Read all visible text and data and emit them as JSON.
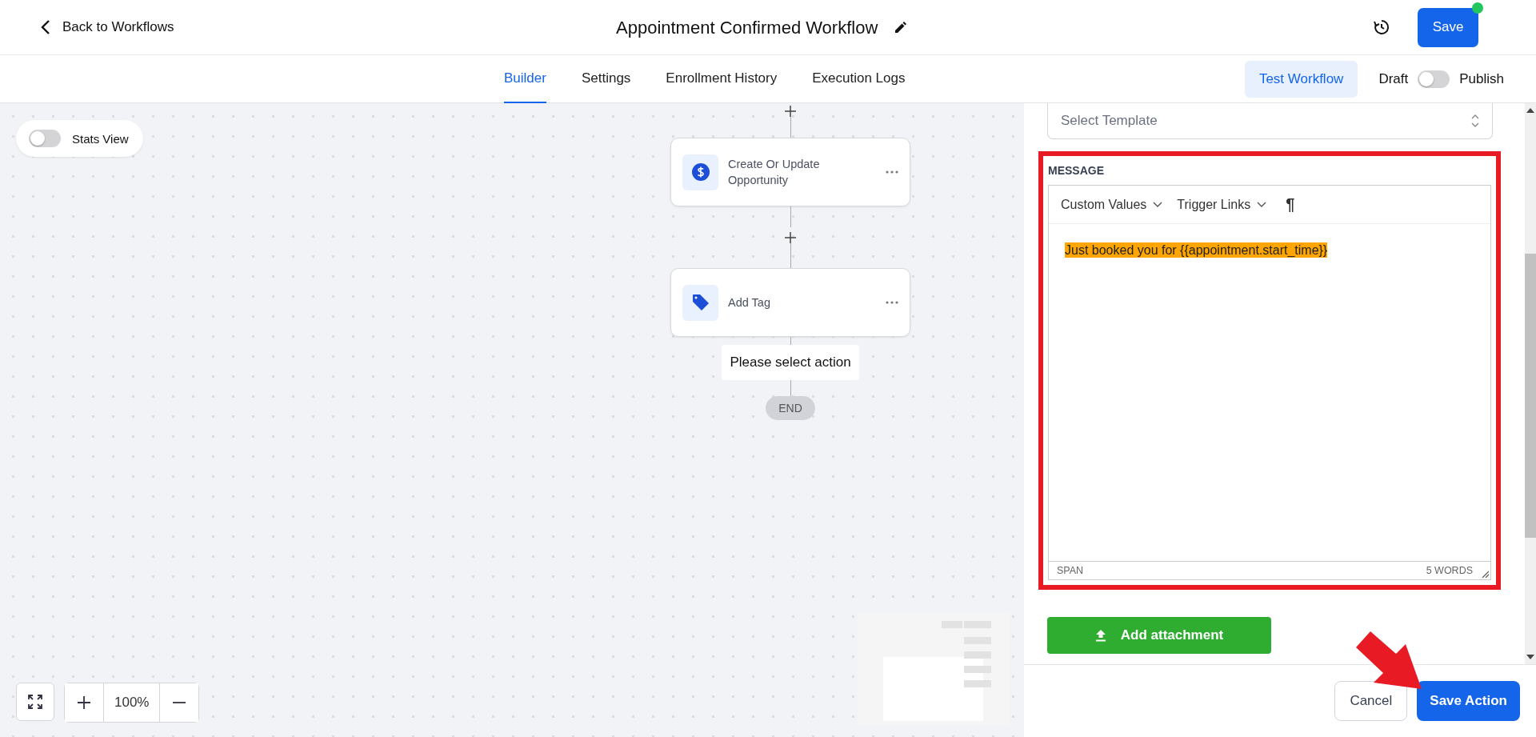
{
  "header": {
    "back_link": "Back to Workflows",
    "title": "Appointment Confirmed Workflow",
    "save_button": "Save",
    "unsaved": true
  },
  "tabs": [
    {
      "label": "Builder",
      "selected": true
    },
    {
      "label": "Settings",
      "selected": false
    },
    {
      "label": "Enrollment History",
      "selected": false
    },
    {
      "label": "Execution Logs",
      "selected": false
    }
  ],
  "test_button": "Test Workflow",
  "publish": {
    "off_label": "Draft",
    "on_label": "Publish",
    "on": false
  },
  "stats_view": {
    "label": "Stats View",
    "on": false
  },
  "nodes": [
    {
      "kind": "opportunity",
      "label": "Create Or Update Opportunity"
    },
    {
      "kind": "tag",
      "label": "Add Tag"
    }
  ],
  "select_action": "Please select action",
  "end_label": "END",
  "zoom": {
    "level": "100%"
  },
  "panel": {
    "template": {
      "placeholder": "Select Template"
    },
    "message_label": "MESSAGE",
    "toolbar": [
      "Custom Values",
      "Trigger Links"
    ],
    "paragraph_symbol": "¶",
    "message": "Just booked you for {{appointment.start_time}}",
    "status_path": "SPAN",
    "word_count": "5 WORDS",
    "attach_button": "Add attachment",
    "cancel_button": "Cancel",
    "save_action_button": "Save Action"
  }
}
